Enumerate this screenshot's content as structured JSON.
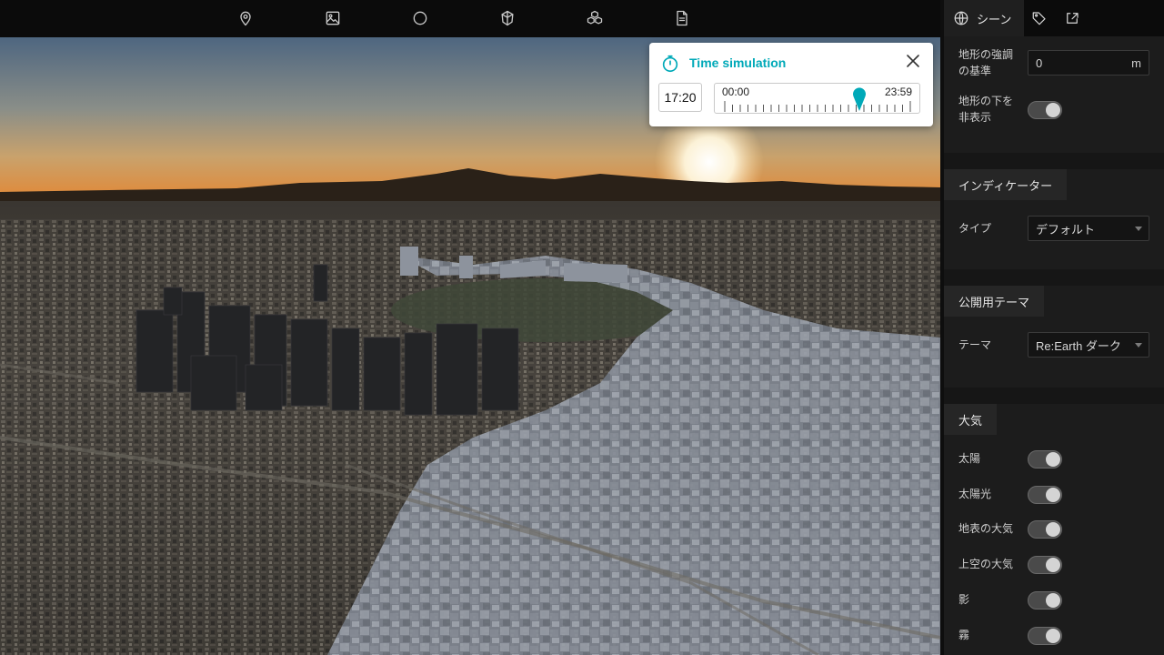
{
  "toolbar": {
    "tools": [
      "pin-icon",
      "image-icon",
      "circle-icon",
      "polygon-icon",
      "boxes-icon",
      "file-icon"
    ]
  },
  "time_simulation": {
    "title": "Time simulation",
    "current_time": "17:20",
    "range_start": "00:00",
    "range_end": "23:59",
    "position_fraction": 0.722,
    "accent_color": "#00a9b8"
  },
  "panel": {
    "tabs": [
      {
        "icon": "globe-icon",
        "label": "シーン",
        "active": true
      },
      {
        "icon": "tag-icon",
        "label": "",
        "active": false
      },
      {
        "icon": "export-icon",
        "label": "",
        "active": false
      }
    ],
    "terrain": {
      "exaggeration_label_line1": "地形の強調",
      "exaggeration_label_line2": "の基準",
      "exaggeration_value": "0",
      "exaggeration_unit": "m",
      "hide_below_label_line1": "地形の下を",
      "hide_below_label_line2": "非表示"
    },
    "indicator": {
      "heading": "インディケーター",
      "type_label": "タイプ",
      "type_value": "デフォルト"
    },
    "theme": {
      "heading": "公開用テーマ",
      "theme_label": "テーマ",
      "theme_value": "Re:Earth ダーク"
    },
    "atmosphere": {
      "heading": "大気",
      "items": [
        "太陽",
        "太陽光",
        "地表の大気",
        "上空の大気",
        "影",
        "霧"
      ]
    }
  }
}
